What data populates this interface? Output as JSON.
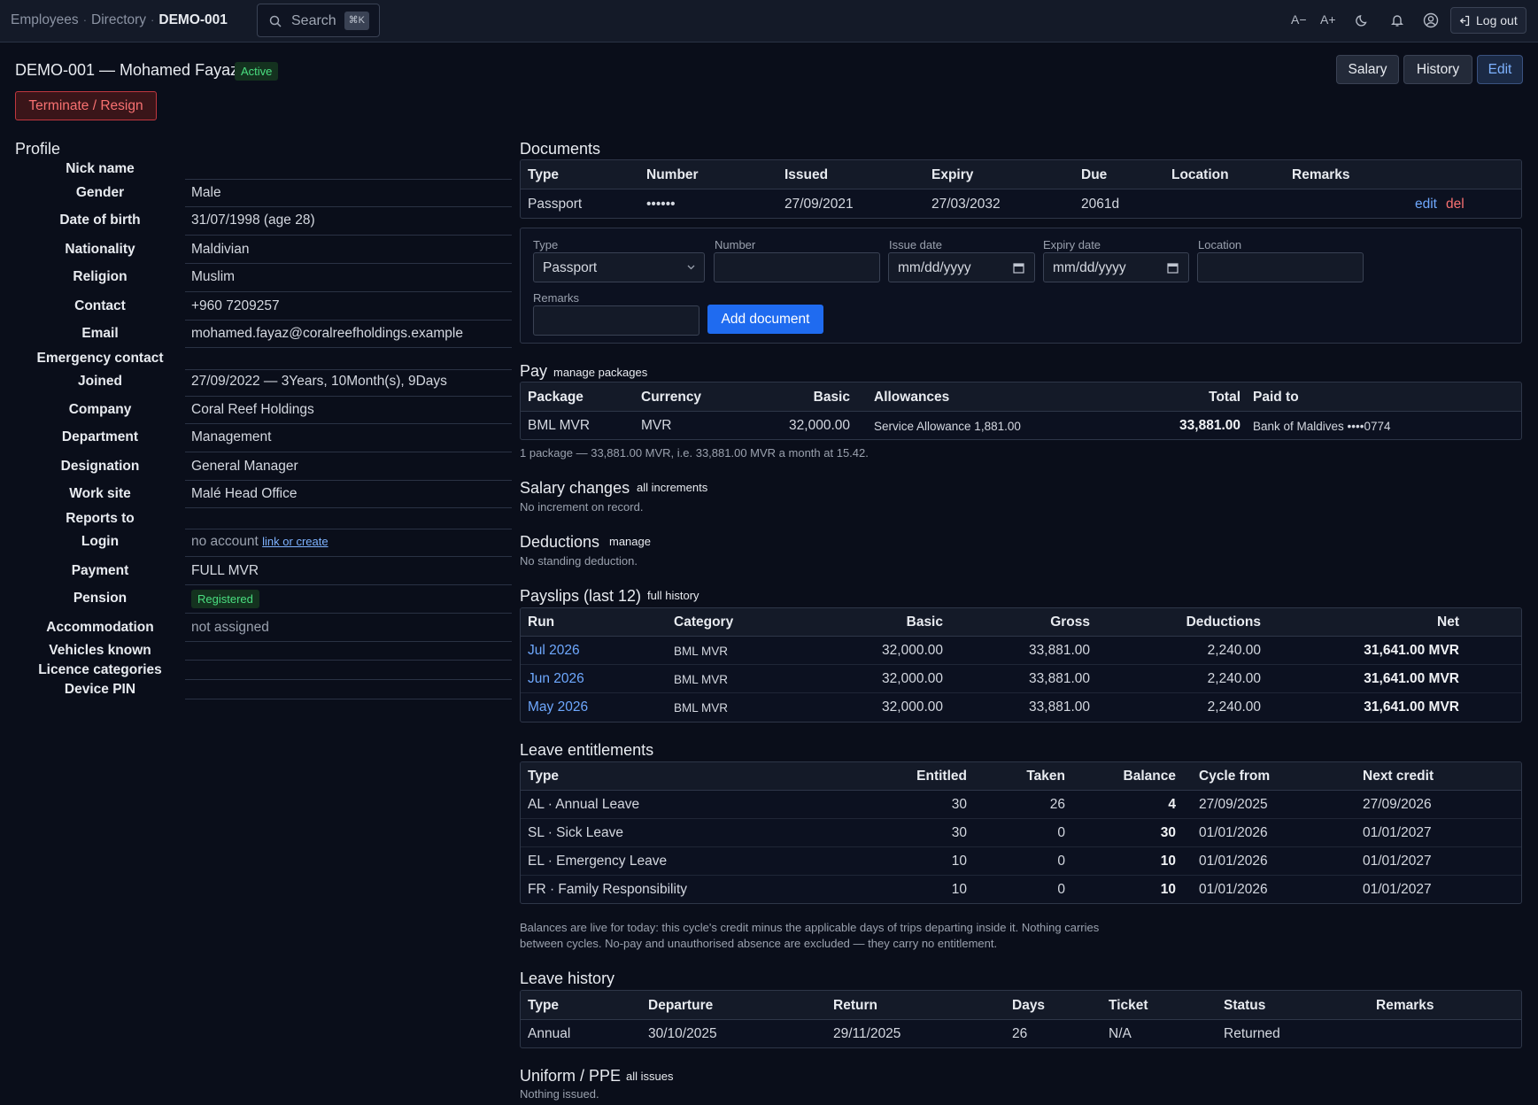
{
  "breadcrumbs": [
    "Employees",
    "Directory",
    "DEMO-001"
  ],
  "search": {
    "label": "Search",
    "shortcut": "⌘K"
  },
  "toolbar": {
    "font_smaller": "A−",
    "font_larger": "A+",
    "logout": "Log out"
  },
  "header": {
    "title": "DEMO-001 — Mohamed Fayaz",
    "status": "Active",
    "buttons": {
      "salary": "Salary",
      "history": "History",
      "edit": "Edit"
    },
    "terminate": "Terminate / Resign"
  },
  "profile": {
    "title": "Profile",
    "rows": [
      {
        "label": "Nick name",
        "value": ""
      },
      {
        "label": "Gender",
        "value": "Male"
      },
      {
        "label": "Date of birth",
        "value": "31/07/1998 (age 28)"
      },
      {
        "label": "Nationality",
        "value": "Maldivian"
      },
      {
        "label": "Religion",
        "value": "Muslim"
      },
      {
        "label": "Contact",
        "value": "+960 7209257"
      },
      {
        "label": "Email",
        "value": "mohamed.fayaz@coralreefholdings.example"
      },
      {
        "label": "Emergency contact",
        "value": ""
      },
      {
        "label": "Joined",
        "value": "27/09/2022 — 3Years, 10Month(s), 9Days"
      },
      {
        "label": "Company",
        "value": "Coral Reef Holdings"
      },
      {
        "label": "Department",
        "value": "Management"
      },
      {
        "label": "Designation",
        "value": "General Manager"
      },
      {
        "label": "Work site",
        "value": "Malé Head Office"
      },
      {
        "label": "Reports to",
        "value": ""
      },
      {
        "label": "Login",
        "value": "no account",
        "link": "link or create"
      },
      {
        "label": "Payment",
        "value": "FULL MVR"
      },
      {
        "label": "Pension",
        "value": "Registered"
      },
      {
        "label": "Accommodation",
        "value": "not assigned"
      },
      {
        "label": "Vehicles known",
        "value": ""
      },
      {
        "label": "Licence categories",
        "value": ""
      },
      {
        "label": "Device PIN",
        "value": ""
      }
    ]
  },
  "documents": {
    "title": "Documents",
    "headers": [
      "Type",
      "Number",
      "Issued",
      "Expiry",
      "Due",
      "Location",
      "Remarks"
    ],
    "rows": [
      {
        "type": "Passport",
        "number": "••••••",
        "issued": "27/09/2021",
        "expiry": "27/03/2032",
        "due": "2061d",
        "location": "",
        "remarks": "",
        "edit": "edit",
        "del": "del"
      }
    ],
    "form": {
      "type_label": "Type",
      "type_value": "Passport",
      "number_label": "Number",
      "issue_label": "Issue date",
      "issue_placeholder": "mm/dd/yyyy",
      "expiry_label": "Expiry date",
      "expiry_placeholder": "mm/dd/yyyy",
      "location_label": "Location",
      "remarks_label": "Remarks",
      "submit": "Add document"
    }
  },
  "pay": {
    "title": "Pay",
    "link": "manage packages",
    "headers": [
      "Package",
      "Currency",
      "Basic",
      "Allowances",
      "Total",
      "Paid to"
    ],
    "rows": [
      {
        "package": "BML MVR",
        "currency": "MVR",
        "basic": "32,000.00",
        "allowances": "Service Allowance 1,881.00",
        "total": "33,881.00",
        "paid_to": "Bank of Maldives ••••0774"
      }
    ],
    "note": "1 package — 33,881.00 MVR, i.e. 33,881.00 MVR a month at 15.42."
  },
  "salary_changes": {
    "title": "Salary changes",
    "link": "all increments",
    "note": "No increment on record."
  },
  "deductions": {
    "title": "Deductions",
    "link": "manage",
    "note": "No standing deduction."
  },
  "payslips": {
    "title": "Payslips (last 12)",
    "link": "full history",
    "headers": [
      "Run",
      "Category",
      "Basic",
      "Gross",
      "Deductions",
      "Net"
    ],
    "rows": [
      {
        "run": "Jul 2026",
        "category": "BML MVR",
        "basic": "32,000.00",
        "gross": "33,881.00",
        "deductions": "2,240.00",
        "net": "31,641.00 MVR"
      },
      {
        "run": "Jun 2026",
        "category": "BML MVR",
        "basic": "32,000.00",
        "gross": "33,881.00",
        "deductions": "2,240.00",
        "net": "31,641.00 MVR"
      },
      {
        "run": "May 2026",
        "category": "BML MVR",
        "basic": "32,000.00",
        "gross": "33,881.00",
        "deductions": "2,240.00",
        "net": "31,641.00 MVR"
      }
    ]
  },
  "leave_entitlements": {
    "title": "Leave entitlements",
    "headers": [
      "Type",
      "Entitled",
      "Taken",
      "Balance",
      "Cycle from",
      "Next credit"
    ],
    "rows": [
      {
        "type": "AL · Annual Leave",
        "entitled": "30",
        "taken": "26",
        "balance": "4",
        "cycle_from": "27/09/2025",
        "next_credit": "27/09/2026"
      },
      {
        "type": "SL · Sick Leave",
        "entitled": "30",
        "taken": "0",
        "balance": "30",
        "cycle_from": "01/01/2026",
        "next_credit": "01/01/2027"
      },
      {
        "type": "EL · Emergency Leave",
        "entitled": "10",
        "taken": "0",
        "balance": "10",
        "cycle_from": "01/01/2026",
        "next_credit": "01/01/2027"
      },
      {
        "type": "FR · Family Responsibility",
        "entitled": "10",
        "taken": "0",
        "balance": "10",
        "cycle_from": "01/01/2026",
        "next_credit": "01/01/2027"
      }
    ],
    "note_line1": "Balances are live for today: this cycle's credit minus the applicable days of trips departing inside it. Nothing carries",
    "note_line2": "between cycles. No-pay and unauthorised absence are excluded — they carry no entitlement."
  },
  "leave_history": {
    "title": "Leave history",
    "headers": [
      "Type",
      "Departure",
      "Return",
      "Days",
      "Ticket",
      "Status",
      "Remarks"
    ],
    "rows": [
      {
        "type": "Annual",
        "departure": "30/10/2025",
        "return": "29/11/2025",
        "days": "26",
        "ticket": "N/A",
        "status": "Returned",
        "remarks": ""
      }
    ]
  },
  "uniform": {
    "title": "Uniform / PPE",
    "link": "all issues",
    "note": "Nothing issued."
  }
}
